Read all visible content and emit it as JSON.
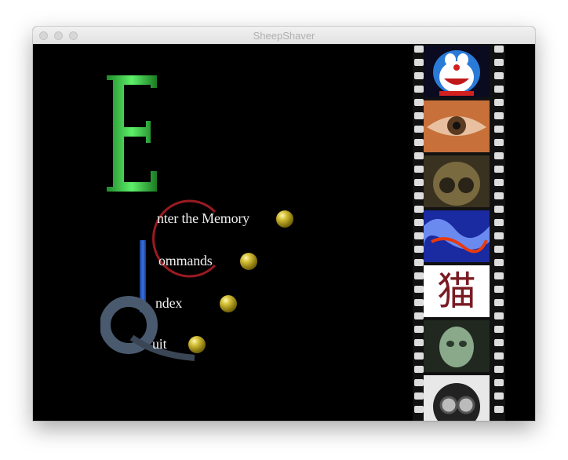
{
  "window": {
    "title": "SheepShaver"
  },
  "menu": {
    "enter_label": "nter the Memory",
    "commands_label": "ommands",
    "index_label": "ndex",
    "quit_label": "uit"
  },
  "filmstrip": {
    "kanji": "猫"
  },
  "colors": {
    "green_letter": "#3fd24a",
    "red_arc": "#9a1a22",
    "blue_bar": "#2050c0",
    "gold_ball": "#c9b32a"
  }
}
